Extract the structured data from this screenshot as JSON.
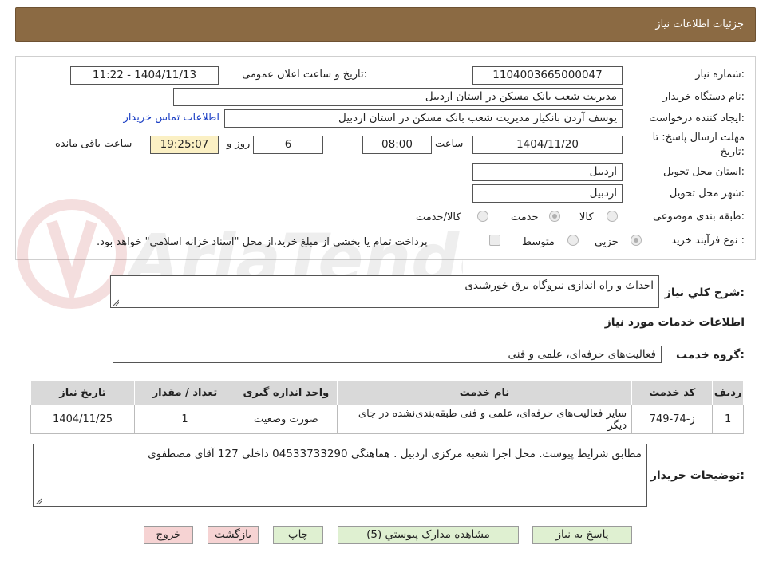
{
  "header": {
    "title": "جزئیات اطلاعات نیاز"
  },
  "form": {
    "need_number_label": "شماره نیاز:",
    "need_number": "1104003665000047",
    "announce_label": "تاریخ و ساعت اعلان عمومی:",
    "announce_value": "1404/11/13 - 11:22",
    "buyer_org_label": "نام دستگاه خریدار:",
    "buyer_org": "مدیریت شعب بانک مسکن در استان اردبیل",
    "requester_label": "ایجاد کننده درخواست:",
    "requester": "یوسف  آردن بانکیار مدیریت شعب بانک مسکن در استان اردبیل",
    "contact_link": "اطلاعات تماس خریدار",
    "deadline_label_1": "مهلت ارسال پاسخ: تا",
    "deadline_label_2": "تاریخ:",
    "deadline_date": "1404/11/20",
    "time_label": "ساعت",
    "deadline_time": "08:00",
    "days_value": "6",
    "days_label": "روز و",
    "remaining_time": "19:25:07",
    "remaining_label": "ساعت باقی مانده",
    "province_label": "استان محل تحویل:",
    "province": "اردبیل",
    "city_label": "شهر محل تحویل:",
    "city": "اردبیل",
    "category_label": "طبقه بندی موضوعی:",
    "category_options": [
      "کالا",
      "خدمت",
      "کالا/خدمت"
    ],
    "category_selected": "خدمت",
    "process_label": "نوع فرآیند خرید :",
    "process_options": [
      "جزیی",
      "متوسط"
    ],
    "process_selected": "جزیی",
    "payment_note": "پرداخت تمام یا بخشی از مبلغ خرید،از محل \"اسناد خزانه اسلامی\" خواهد بود."
  },
  "summary": {
    "label": "شرح کلي نياز:",
    "text": "احداث و راه اندازی نیروگاه برق خورشیدی"
  },
  "services": {
    "section_title": "اطلاعات خدمات مورد نیاز",
    "group_label": "گروه خدمت:",
    "group_value": "فعالیت‌های حرفه‌ای، علمی و فنی",
    "columns": [
      "ردیف",
      "کد خدمت",
      "نام خدمت",
      "واحد اندازه گیری",
      "تعداد / مقدار",
      "تاریخ نیاز"
    ],
    "rows": [
      {
        "index": "1",
        "code": "ز-74-749",
        "name": "سایر فعالیت‌های حرفه‌ای، علمی و فنی طبقه‌بندی‌نشده در جای دیگر",
        "unit": "صورت وضعیت",
        "qty": "1",
        "date": "1404/11/25"
      }
    ]
  },
  "buyer_notes": {
    "label": "توضیحات خریدار:",
    "text": "مطابق شرایط پیوست. محل اجرا شعبه مرکزی اردبیل . هماهنگی 04533733290 داخلی 127 آقای مصطفوی"
  },
  "buttons": {
    "reply": "پاسخ به نیاز",
    "attachments": "مشاهده مدارک پیوستي (5)",
    "print": "چاپ",
    "back": "بازگشت",
    "exit": "خروج"
  },
  "watermark": {
    "text": "AriaTender.neT"
  },
  "colors": {
    "header_bg": "#8b6a43",
    "link": "#1a3ec4",
    "green_button": "#dff0d1",
    "red_button": "#f6d3d3",
    "remaining_bg": "#fbf0c4"
  }
}
